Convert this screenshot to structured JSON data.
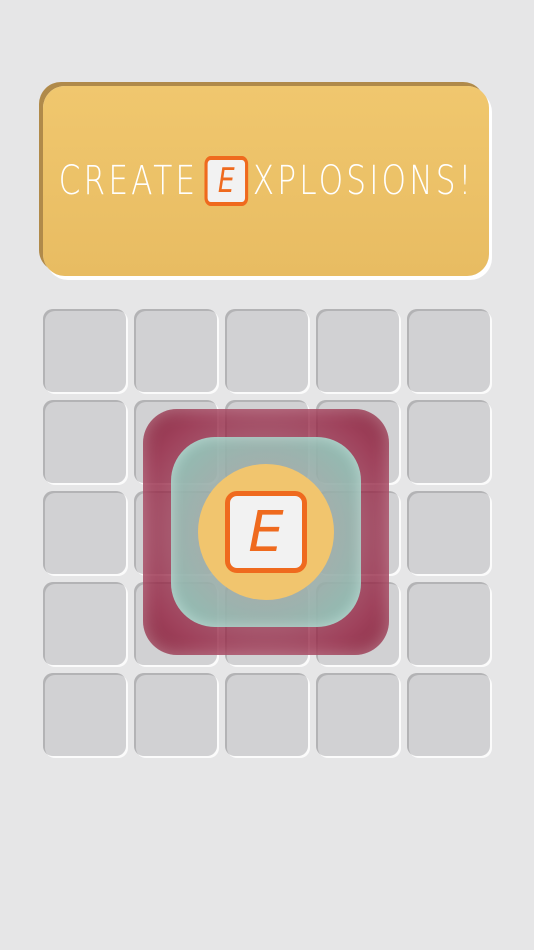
{
  "banner": {
    "prefix": "CREATE",
    "logo_letter": "E",
    "suffix": "XPLOSIONS!"
  },
  "board": {
    "rows": 5,
    "cols": 5,
    "center_tile_letter": "E"
  },
  "colors": {
    "background": "#e6e6e7",
    "banner": "#f0c76e",
    "logo_orange": "#ef6a1e",
    "cell": "#d1d1d3",
    "explosion_red": "#96284a",
    "explosion_teal": "#8ccdbe",
    "explosion_yellow": "#f1c56e"
  }
}
